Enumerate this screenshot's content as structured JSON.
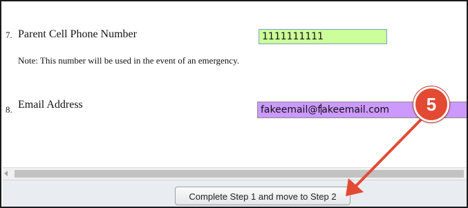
{
  "form": {
    "phone_row": {
      "number": "7.",
      "label": "Parent Cell Phone Number",
      "note": "Note: This number will be used in the event of an emergency.",
      "value": "1111111111"
    },
    "email_row": {
      "number": "8.",
      "label": "Email Address",
      "value_before_caret": "fakeemail@f",
      "value_after_caret": "akeemail.com"
    }
  },
  "footer": {
    "button_label": "Complete Step 1 and move to Step 2"
  },
  "annotation": {
    "badge_text": "5",
    "color": "#e24a34"
  },
  "colors": {
    "phone_field_bg": "#ccff99",
    "email_field_bg": "#cc99ff"
  }
}
